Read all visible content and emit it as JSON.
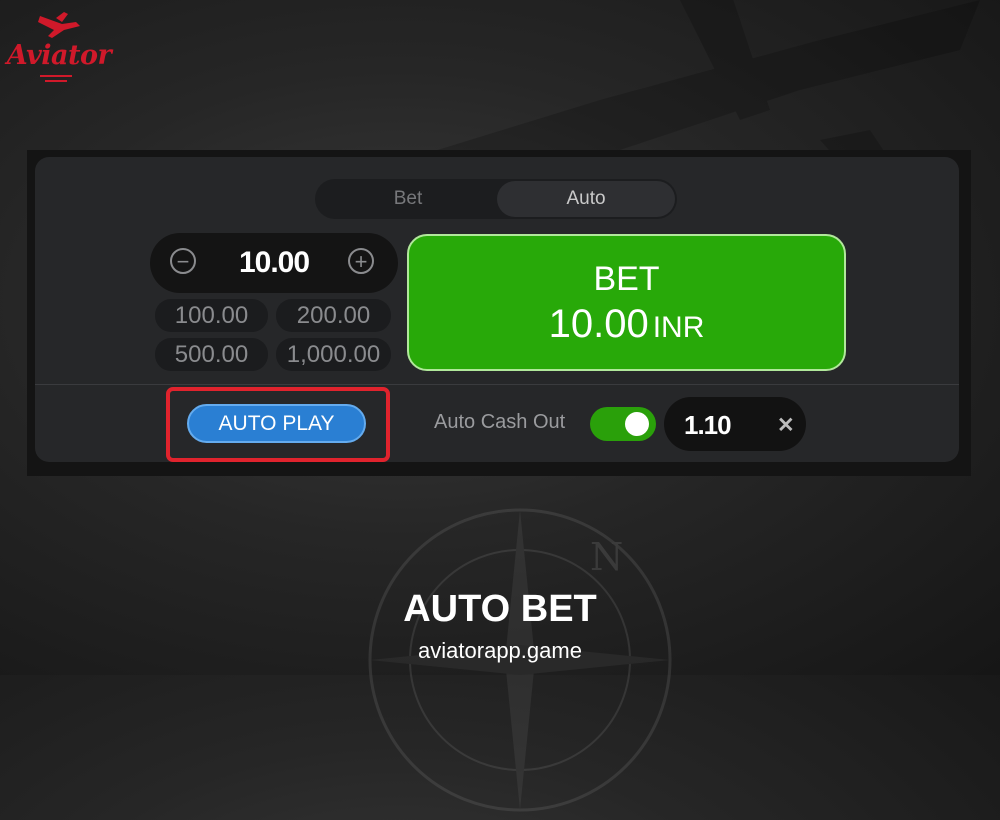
{
  "brand": {
    "logo_text": "Aviator",
    "accent": "#d0192a"
  },
  "tabs": [
    {
      "label": "Bet",
      "active": false
    },
    {
      "label": "Auto",
      "active": true
    }
  ],
  "stepper": {
    "value": "10.00",
    "minus_icon": "minus-circle-icon",
    "plus_icon": "plus-circle-icon"
  },
  "quick_amounts": [
    "100.00",
    "200.00",
    "500.00",
    "1,000.00"
  ],
  "bet_button": {
    "label": "BET",
    "amount": "10.00",
    "currency": "INR",
    "color": "#28a909"
  },
  "auto_play": {
    "label": "AUTO PLAY",
    "color": "#2a7fd3",
    "highlight_color": "#e0232d"
  },
  "auto_cash_out": {
    "label": "Auto Cash Out",
    "enabled": true,
    "multiplier": "1.10",
    "clear_icon": "close-icon"
  },
  "caption": {
    "title": "AUTO BET",
    "subtitle": "aviatorapp.game"
  }
}
